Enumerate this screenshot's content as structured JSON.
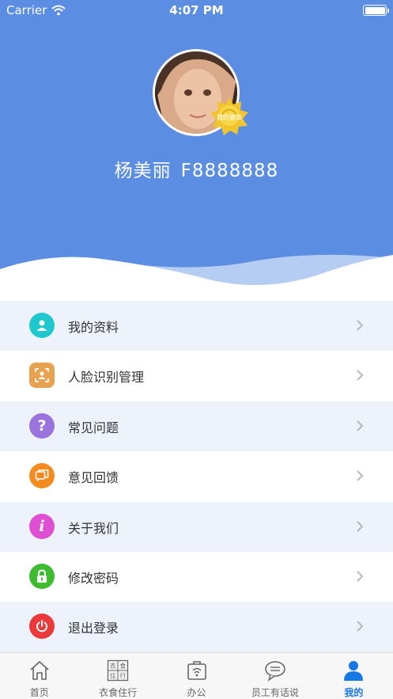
{
  "status_bar": {
    "carrier": "Carrier",
    "time": "4:07 PM"
  },
  "profile": {
    "badge_text": "我的徽章",
    "name": "杨美丽",
    "employee_id": "F8888888"
  },
  "menu": {
    "items": [
      {
        "label": "我的资料",
        "icon": "user-icon",
        "color": "#1ec8cf"
      },
      {
        "label": "人脸识别管理",
        "icon": "face-scan-icon",
        "color": "#e8a24f"
      },
      {
        "label": "常见问题",
        "icon": "question-icon",
        "color": "#9a73df"
      },
      {
        "label": "意见回馈",
        "icon": "feedback-icon",
        "color": "#f58a1f"
      },
      {
        "label": "关于我们",
        "icon": "info-icon",
        "color": "#df4fd4"
      },
      {
        "label": "修改密码",
        "icon": "lock-icon",
        "color": "#3cbc2e"
      },
      {
        "label": "退出登录",
        "icon": "power-icon",
        "color": "#ec3a3a"
      }
    ]
  },
  "tabbar": {
    "tabs": [
      {
        "label": "首页",
        "icon": "home-icon"
      },
      {
        "label": "衣食住行",
        "icon": "clothing-food-housing-travel-icon"
      },
      {
        "label": "办公",
        "icon": "briefcase-icon"
      },
      {
        "label": "员工有话说",
        "icon": "chat-icon"
      },
      {
        "label": "我的",
        "icon": "profile-icon"
      }
    ],
    "active_index": 4,
    "active_color": "#1677e6"
  },
  "colors": {
    "header": "#5b8de3",
    "row_alt": "#eef2fb"
  }
}
